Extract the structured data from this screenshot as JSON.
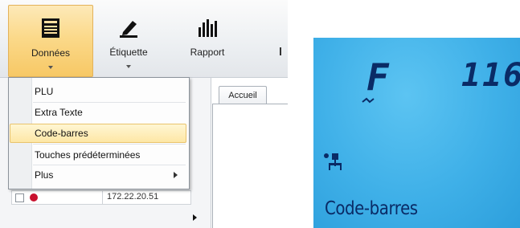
{
  "ribbon": {
    "buttons": [
      {
        "label": "Données",
        "icon": "document-list-icon",
        "active": true
      },
      {
        "label": "Étiquette",
        "icon": "pen-tag-icon",
        "active": false
      },
      {
        "label": "Rapport",
        "icon": "bar-chart-icon",
        "active": false
      }
    ]
  },
  "menu": {
    "items": [
      {
        "label": "PLU"
      },
      {
        "label": "Extra Texte"
      },
      {
        "label": "Code-barres",
        "highlighted": true
      },
      {
        "label": "Touches prédéterminées"
      },
      {
        "label": "Plus",
        "has_submenu": true
      }
    ]
  },
  "workspace": {
    "tab_label": "Accueil",
    "row_partial_text": "172.22.20.51"
  },
  "lcd": {
    "segment_left": "F",
    "segment_right": "116",
    "bottom_text": "Code-barres",
    "colors": {
      "background": "#3fb0e8",
      "ink": "#0a2b66"
    }
  }
}
